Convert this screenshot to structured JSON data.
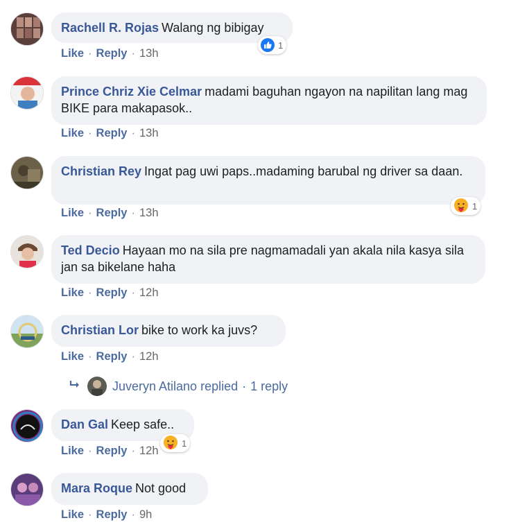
{
  "comments": [
    {
      "name": "Rachell R. Rojas",
      "text": "Walang ng bibigay",
      "like": "Like",
      "reply": "Reply",
      "time": "13h",
      "reaction_count": "1",
      "reaction_icon": "like-reaction-icon"
    },
    {
      "name": "Prince Chriz Xie Celmar",
      "text": "madami baguhan ngayon na napilitan lang mag BIKE para makapasok..",
      "like": "Like",
      "reply": "Reply",
      "time": "13h"
    },
    {
      "name": "Christian Rey",
      "text": "Ingat pag uwi paps..madaming barubal ng driver sa daan.",
      "like": "Like",
      "reply": "Reply",
      "time": "13h",
      "reaction_count": "1",
      "reaction_icon": "care-reaction-icon"
    },
    {
      "name": "Ted Decio",
      "text": "Hayaan mo na sila pre nagmamadali yan akala nila kasya sila jan sa bikelane haha",
      "like": "Like",
      "reply": "Reply",
      "time": "12h"
    },
    {
      "name": "Christian Lor",
      "text": "bike to work ka juvs?",
      "like": "Like",
      "reply": "Reply",
      "time": "12h"
    },
    {
      "name": "Dan Gal",
      "text": "Keep safe..",
      "like": "Like",
      "reply": "Reply",
      "time": "12h",
      "reaction_count": "1",
      "reaction_icon": "care-reaction-icon"
    },
    {
      "name": "Mara Roque",
      "text": "Not good",
      "like": "Like",
      "reply": "Reply",
      "time": "9h"
    }
  ],
  "reply_thread": {
    "replier": "Juveryn Atilano replied",
    "dot": "·",
    "count": "1 reply",
    "arrow_icon": "reply-arrow-icon"
  },
  "separator": "·",
  "colors": {
    "name": "#385898",
    "bubble": "#f0f2f5",
    "action": "#4b6aa0",
    "like_blue": "#1877f2",
    "care_yellow": "#f7b125"
  }
}
